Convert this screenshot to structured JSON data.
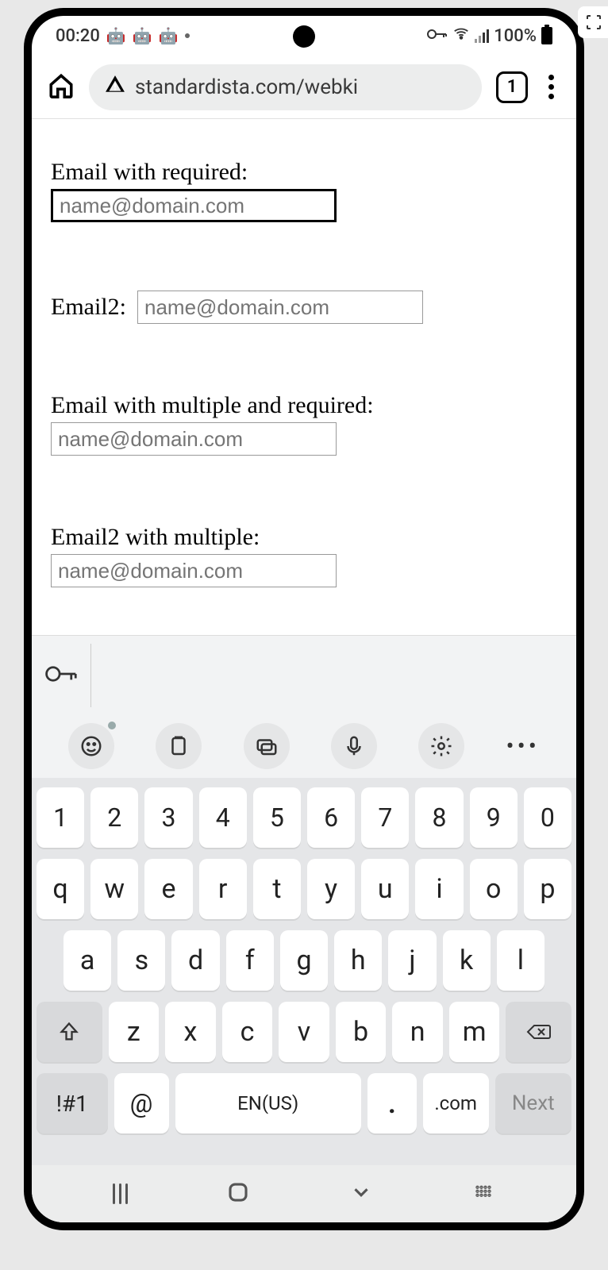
{
  "status": {
    "time": "00:20",
    "battery_pct": "100%"
  },
  "browser": {
    "url": "standardista.com/webki",
    "tab_count": "1"
  },
  "form": {
    "f1_label": "Email with required:",
    "f1_placeholder": "name@domain.com",
    "f2_label": "Email2:",
    "f2_placeholder": "name@domain.com",
    "f3_label": "Email with multiple and required:",
    "f3_placeholder": "name@domain.com",
    "f4_label": "Email2 with multiple:",
    "f4_placeholder": "name@domain.com"
  },
  "keyboard": {
    "row_num": [
      "1",
      "2",
      "3",
      "4",
      "5",
      "6",
      "7",
      "8",
      "9",
      "0"
    ],
    "row_q": [
      "q",
      "w",
      "e",
      "r",
      "t",
      "y",
      "u",
      "i",
      "o",
      "p"
    ],
    "row_a": [
      "a",
      "s",
      "d",
      "f",
      "g",
      "h",
      "j",
      "k",
      "l"
    ],
    "row_z": [
      "z",
      "x",
      "c",
      "v",
      "b",
      "n",
      "m"
    ],
    "sym": "!#1",
    "at": "@",
    "space": "EN(US)",
    "period": ".",
    "com": ".com",
    "next": "Next"
  }
}
